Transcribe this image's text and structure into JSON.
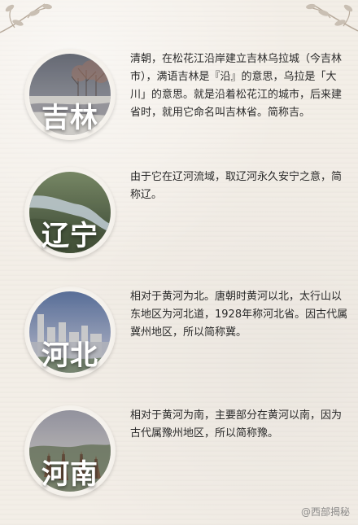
{
  "regions": [
    {
      "name": "吉林",
      "description": "清朝，在松花江沿岸建立吉林乌拉城（今吉林市），满语吉林是『沿』的意思，乌拉是「大川」的意思。就是沿着松花江的城市，后来建省时，就用它命名叫吉林省。简称吉。"
    },
    {
      "name": "辽宁",
      "description": "由于它在辽河流域，取辽河永久安宁之意，简称辽。"
    },
    {
      "name": "河北",
      "description": "相对于黄河为北。唐朝时黄河以北，太行山以东地区为河北道，1928年称河北省。因古代属冀州地区，所以简称冀。"
    },
    {
      "name": "河南",
      "description": "相对于黄河为南，主要部分在黄河以南，因为古代属豫州地区，所以简称豫。"
    }
  ],
  "watermark": "@西部揭秘"
}
